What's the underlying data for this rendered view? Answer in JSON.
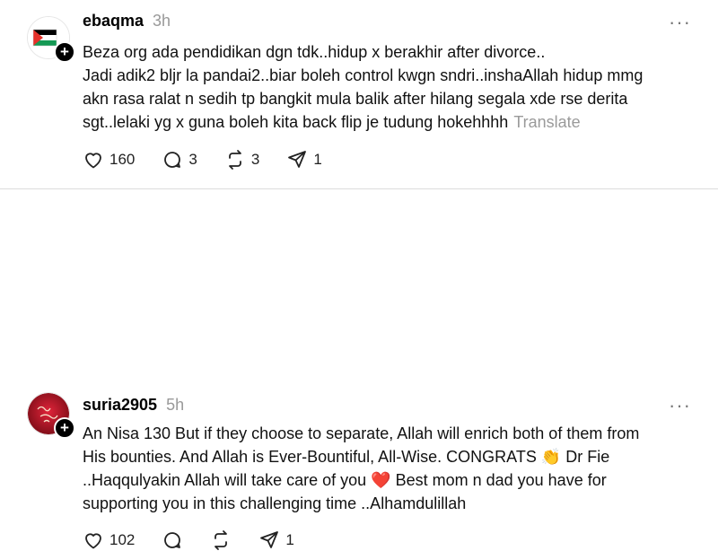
{
  "posts": [
    {
      "username": "ebaqma",
      "time": "3h",
      "more": "···",
      "lines": [
        "Beza org ada pendidikan dgn tdk..hidup x berakhir after divorce..",
        "Jadi adik2 bljr la pandai2..biar boleh control kwgn sndri..inshaAllah hidup mmg",
        "akn rasa ralat n sedih tp bangkit mula balik after hilang segala xde rse derita",
        "sgt..lelaki yg x guna boleh kita back flip je tudung hokehhhh"
      ],
      "translate": "Translate",
      "likes": "160",
      "replies": "3",
      "reposts": "3",
      "shares": "1"
    },
    {
      "username": "suria2905",
      "time": "5h",
      "more": "···",
      "lines": [
        "An Nisa 130 But if they choose to separate, Allah will enrich both of them from",
        "His bounties. And Allah is Ever-Bountiful, All-Wise. CONGRATS 👏 Dr Fie",
        "..Haqqulyakin Allah will take care of you ❤️ Best mom n dad you have for",
        "supporting you in this challenging time ..Alhamdulillah"
      ],
      "likes": "102",
      "shares": "1"
    }
  ],
  "follow_symbol": "+",
  "icons": {
    "like": "heart-icon",
    "reply": "comment-icon",
    "repost": "repost-icon",
    "share": "share-icon",
    "more": "more-icon"
  }
}
